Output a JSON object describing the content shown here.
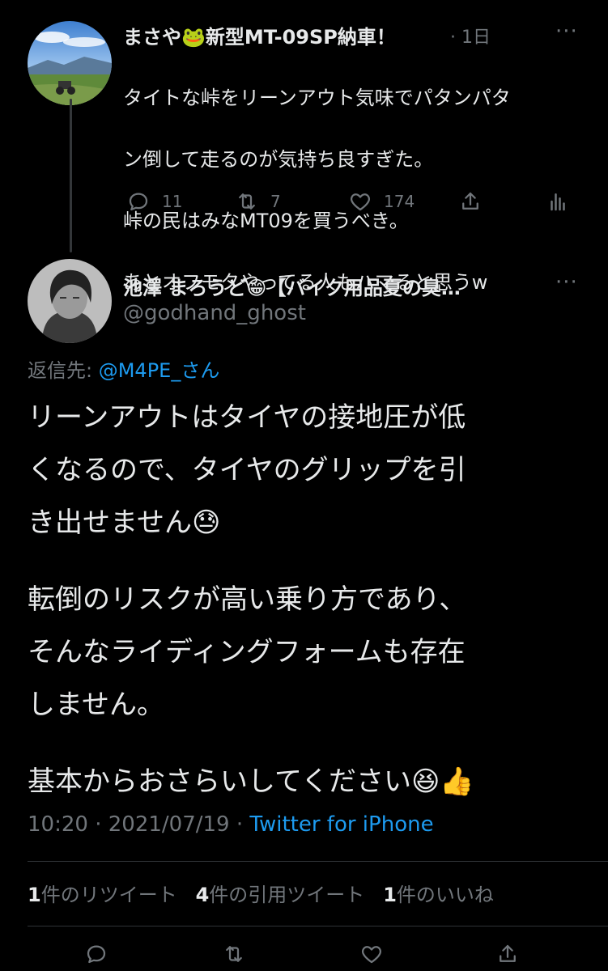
{
  "quoted_tweet": {
    "display_name": "まさや🐸新型MT-09SP納車！",
    "time": "· 1日",
    "more": "···",
    "body": "タイトな峠をリーンアウト気味でパタンパタン倒して走るのが気持ち良すぎた。\n峠の民はみなMT09を買うべき。\nあとオフモタやってる人もハマると思うw",
    "body_lines": [
      "タイトな峠をリーンアウト気味でパタンパタ",
      "ン倒して走るのが気持ち良すぎた。",
      "峠の民はみなMT09を買うべき。",
      "あとオフモタやってる人もハマると思うw"
    ],
    "actions": {
      "reply_count": "11",
      "retweet_count": "7",
      "like_count": "174"
    },
    "avatar_icon": "profile-photo-landscape-motorcycle"
  },
  "main_tweet": {
    "display_name": "池澤 まろうど😁【バイク用品夏の臭…",
    "handle": "@godhand_ghost",
    "more": "···",
    "reply_to_label": "返信先: ",
    "reply_to_user": "@M4PE_さん",
    "paragraphs": [
      "リーンアウトはタイヤの接地圧が低\nくなるので、タイヤのグリップを引\nき出せません😓",
      "転倒のリスクが高い乗り方であり、\nそんなライディングフォームも存在\nしません。",
      "基本からおさらいしてください😆👍"
    ],
    "time": "10:20",
    "date": "2021/07/19",
    "separator": " · ",
    "source": "Twitter for iPhone",
    "avatar_icon": "profile-photo-grayscale-portrait"
  },
  "stats": {
    "retweets_num": "1",
    "retweets_label": "件のリツイート",
    "quotes_num": "4",
    "quotes_label": "件の引用ツイート",
    "likes_num": "1",
    "likes_label": "件のいいね"
  },
  "colors": {
    "background": "#000000",
    "text": "#e7e9ea",
    "muted": "#71767b",
    "link": "#1d9bf0",
    "divider": "#2f3336"
  }
}
